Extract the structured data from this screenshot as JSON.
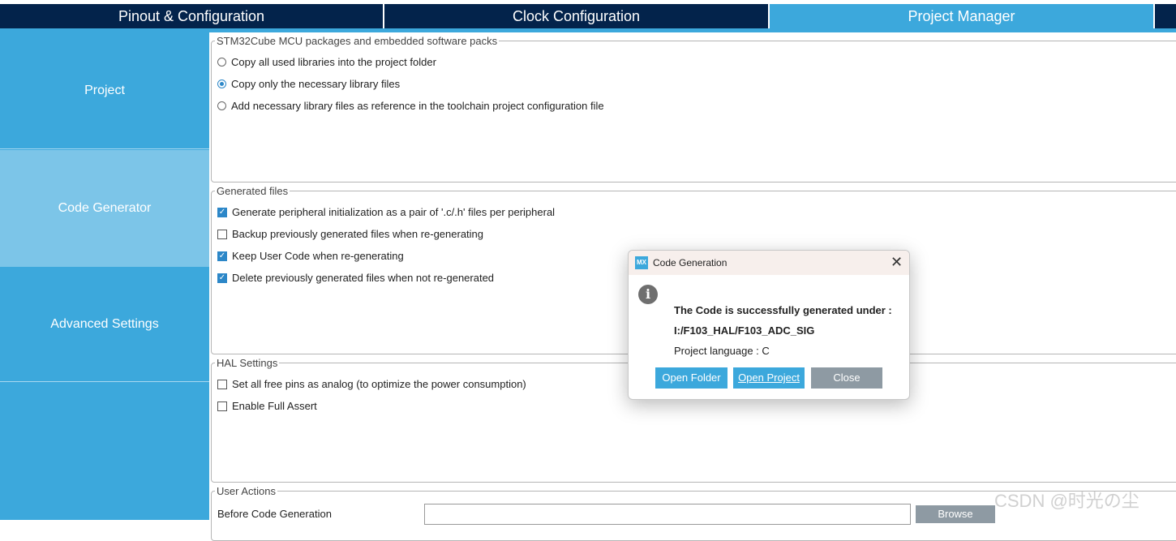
{
  "tabs": [
    {
      "label": "Pinout & Configuration"
    },
    {
      "label": "Clock Configuration"
    },
    {
      "label": "Project Manager"
    }
  ],
  "sidebar": {
    "items": [
      {
        "label": "Project"
      },
      {
        "label": "Code Generator"
      },
      {
        "label": "Advanced Settings"
      }
    ]
  },
  "mcu_packages": {
    "legend": "STM32Cube MCU packages and embedded software packs",
    "options": [
      {
        "label": "Copy all used libraries into the project folder",
        "selected": false
      },
      {
        "label": "Copy only the necessary library files",
        "selected": true
      },
      {
        "label": "Add necessary library files as reference in the toolchain project configuration file",
        "selected": false
      }
    ]
  },
  "generated_files": {
    "legend": "Generated files",
    "options": [
      {
        "label": "Generate peripheral initialization as a pair of '.c/.h' files per peripheral",
        "checked": true
      },
      {
        "label": "Backup previously generated files when re-generating",
        "checked": false
      },
      {
        "label": "Keep User Code when re-generating",
        "checked": true
      },
      {
        "label": "Delete previously generated files when not re-generated",
        "checked": true
      }
    ]
  },
  "hal_settings": {
    "legend": "HAL Settings",
    "options": [
      {
        "label": "Set all free pins as analog (to optimize the power consumption)",
        "checked": false
      },
      {
        "label": "Enable Full Assert",
        "checked": false
      }
    ]
  },
  "user_actions": {
    "legend": "User Actions",
    "before_label": "Before Code Generation",
    "browse_label": "Browse"
  },
  "dialog": {
    "icon_text": "MX",
    "title": "Code Generation",
    "close_glyph": "✕",
    "info_glyph": "i",
    "line1": "The Code is successfully generated under :",
    "line2": "I:/F103_HAL/F103_ADC_SIG",
    "line3": "Project language : C",
    "buttons": {
      "open_folder": "Open Folder",
      "open_project": "Open Project",
      "close": "Close"
    }
  },
  "watermark": "CSDN @时光の尘",
  "colors": {
    "tab_dark": "#03234b",
    "accent": "#3ca8dc",
    "sidebar_selected": "#7cc5e8",
    "button_gray": "#8e9aa3"
  }
}
